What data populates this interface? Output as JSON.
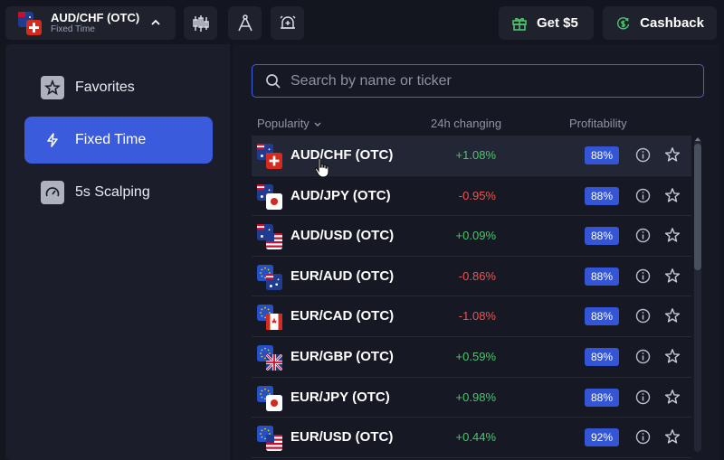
{
  "topbar": {
    "asset_title": "AUD/CHF (OTC)",
    "asset_subtitle": "Fixed Time",
    "get_bonus_label": "Get $5",
    "cashback_label": "Cashback"
  },
  "sidebar": {
    "items": [
      {
        "label": "Favorites",
        "icon": "star-icon",
        "active": false
      },
      {
        "label": "Fixed Time",
        "icon": "lightning-icon",
        "active": true
      },
      {
        "label": "5s Scalping",
        "icon": "gauge-icon",
        "active": false
      }
    ]
  },
  "search": {
    "placeholder": "Search by name or ticker",
    "value": ""
  },
  "table": {
    "headers": {
      "name": "Popularity",
      "change": "24h changing",
      "profit": "Profitability"
    },
    "rows": [
      {
        "name": "AUD/CHF (OTC)",
        "change": "+1.08%",
        "profit": "88%",
        "base": "AU",
        "quote": "CH"
      },
      {
        "name": "AUD/JPY (OTC)",
        "change": "-0.95%",
        "profit": "88%",
        "base": "AU",
        "quote": "JP"
      },
      {
        "name": "AUD/USD (OTC)",
        "change": "+0.09%",
        "profit": "88%",
        "base": "AU",
        "quote": "US"
      },
      {
        "name": "EUR/AUD (OTC)",
        "change": "-0.86%",
        "profit": "88%",
        "base": "EU",
        "quote": "AU"
      },
      {
        "name": "EUR/CAD (OTC)",
        "change": "-1.08%",
        "profit": "88%",
        "base": "EU",
        "quote": "CA"
      },
      {
        "name": "EUR/GBP (OTC)",
        "change": "+0.59%",
        "profit": "89%",
        "base": "EU",
        "quote": "GB"
      },
      {
        "name": "EUR/JPY (OTC)",
        "change": "+0.98%",
        "profit": "88%",
        "base": "EU",
        "quote": "JP"
      },
      {
        "name": "EUR/USD (OTC)",
        "change": "+0.44%",
        "profit": "92%",
        "base": "EU",
        "quote": "US"
      }
    ]
  },
  "colors": {
    "accent": "#3a5bdb",
    "positive": "#4cc56e",
    "negative": "#ef5350",
    "badge": "#3355d6"
  }
}
